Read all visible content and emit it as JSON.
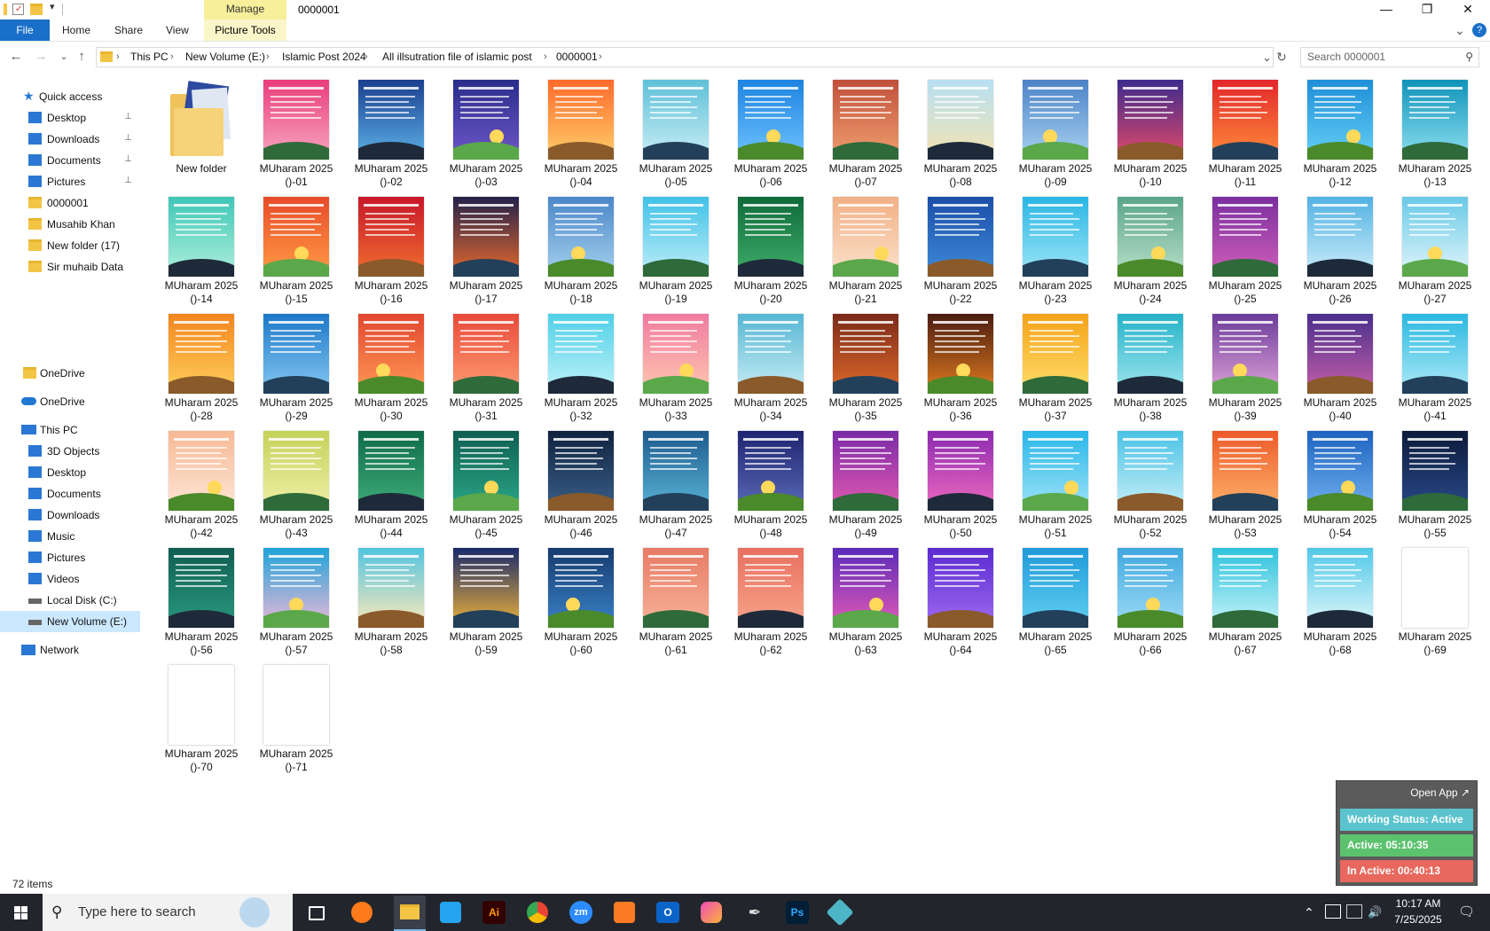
{
  "window": {
    "manage_tab": "Manage",
    "title": "0000001",
    "minimize_glyph": "—",
    "restore_glyph": "❐",
    "close_glyph": "✕"
  },
  "ribbon": {
    "tabs": [
      "File",
      "Home",
      "Share",
      "View",
      "Picture Tools"
    ],
    "collapse_glyph": "⌄",
    "help_glyph": "?"
  },
  "address": {
    "crumbs": [
      "This PC",
      "New Volume (E:)",
      "Islamic Post 2024",
      "All illsutration file of islamic post",
      "0000001"
    ],
    "search_placeholder": "Search 0000001",
    "back_glyph": "←",
    "forward_glyph": "→",
    "recent_glyph": "⌄",
    "up_glyph": "↑",
    "refresh_glyph": "↻",
    "sep_glyph": "›",
    "dropdown_glyph": "⌄",
    "search_glyph": "⚲"
  },
  "sidebar": {
    "quick_access": "Quick access",
    "quick_items": [
      {
        "label": "Desktop",
        "icon": "desktop-icon",
        "pinned": true
      },
      {
        "label": "Downloads",
        "icon": "downloads-icon",
        "pinned": true
      },
      {
        "label": "Documents",
        "icon": "documents-icon",
        "pinned": true
      },
      {
        "label": "Pictures",
        "icon": "pictures-icon",
        "pinned": true
      },
      {
        "label": "0000001",
        "icon": "folder-icon",
        "pinned": false
      },
      {
        "label": "Musahib Khan",
        "icon": "folder-icon",
        "pinned": false
      },
      {
        "label": "New folder (17)",
        "icon": "folder-icon",
        "pinned": false
      },
      {
        "label": "Sir muhaib Data",
        "icon": "folder-icon",
        "pinned": false
      }
    ],
    "onedrive_personal": "OneDrive",
    "onedrive": "OneDrive",
    "this_pc": "This PC",
    "pc_items": [
      {
        "label": "3D Objects",
        "icon": "3d-objects-icon"
      },
      {
        "label": "Desktop",
        "icon": "desktop-icon"
      },
      {
        "label": "Documents",
        "icon": "documents-icon"
      },
      {
        "label": "Downloads",
        "icon": "downloads-icon"
      },
      {
        "label": "Music",
        "icon": "music-icon"
      },
      {
        "label": "Pictures",
        "icon": "pictures-icon"
      },
      {
        "label": "Videos",
        "icon": "videos-icon"
      },
      {
        "label": "Local Disk (C:)",
        "icon": "local-disk-icon"
      },
      {
        "label": "New Volume (E:)",
        "icon": "drive-icon",
        "selected": true
      }
    ],
    "network": "Network",
    "pin_glyph": "📌"
  },
  "files": {
    "folder_label": "New folder",
    "name_prefix": "MUharam 2025",
    "name_suffix_prefix": "()-",
    "count": 71,
    "blank_numbers": [
      69,
      70,
      71
    ]
  },
  "status": {
    "items_count": "72 items"
  },
  "tracker": {
    "open_app": "Open App ↗",
    "working_status": "Working Status: Active",
    "active": "Active: 05:10:35",
    "inactive": "In Active: 00:40:13",
    "colors": {
      "working": "#5bc3cd",
      "active": "#5cc26e",
      "inactive": "#e8685e"
    }
  },
  "taskbar": {
    "search_placeholder": "Type here to search",
    "apps": [
      "task-view",
      "firefox",
      "file-explorer",
      "vscode",
      "illustrator",
      "chrome",
      "zoom",
      "xampp",
      "outlook",
      "photoshop-express",
      "pen-tool",
      "photoshop",
      "tracker-app"
    ],
    "photoshop_label": "Ps",
    "illustrator_label": "Ai",
    "zoom_label": "zm",
    "outlook_label": "O",
    "time": "10:17 AM",
    "date": "7/25/2025",
    "tray_up_glyph": "⌃",
    "speaker_glyph": "🔊",
    "notif_glyph": "🗨"
  },
  "colors": {
    "accent": "#1a6fc9",
    "selection": "#cce8ff"
  }
}
